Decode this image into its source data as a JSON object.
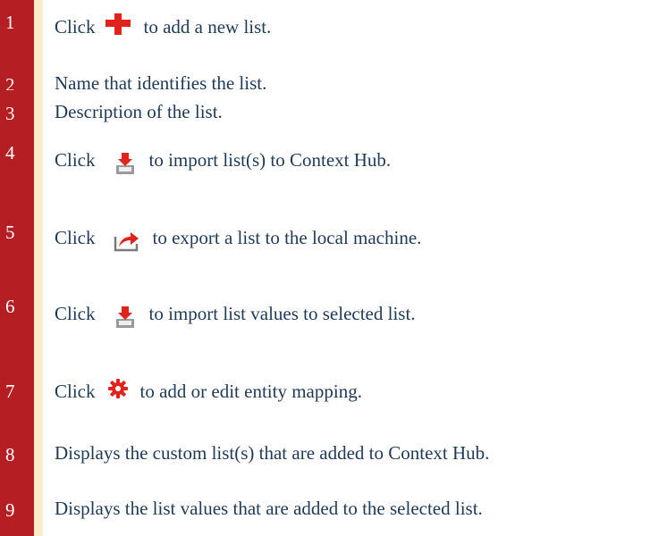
{
  "rows": [
    {
      "number": "1",
      "text_before": "Click",
      "icon": "add-plus-icon",
      "text_after": "to add a new list."
    },
    {
      "number": "2",
      "text": "Name that identifies the list."
    },
    {
      "number": "3",
      "text": "Description of the list."
    },
    {
      "number": "4",
      "text_before": "Click",
      "icon": "import-icon",
      "text_after": "to import list(s) to Context Hub."
    },
    {
      "number": "5",
      "text_before": "Click",
      "icon": "export-icon",
      "text_after": "to export a list to the local machine."
    },
    {
      "number": "6",
      "text_before": "Click",
      "icon": "import-icon",
      "text_after": "to import list values to selected list."
    },
    {
      "number": "7",
      "text_before": "Click",
      "icon": "gear-icon",
      "text_after": "to add or edit entity mapping."
    },
    {
      "number": "8",
      "text": "Displays the custom list(s) that are added to Context Hub."
    },
    {
      "number": "9",
      "text": "Displays the list values that are added to the selected list."
    }
  ],
  "colors": {
    "number_column": "#b51f23",
    "accent_bar": "#f8edc6",
    "body_text": "#1f3a57",
    "icon_red": "#e0231c"
  }
}
